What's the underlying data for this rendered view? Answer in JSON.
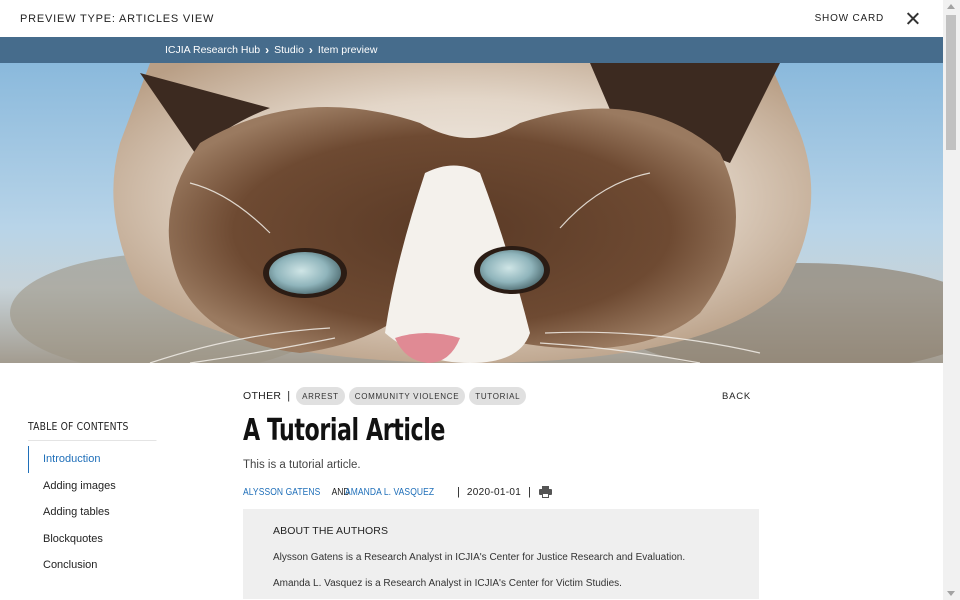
{
  "topbar": {
    "title": "PREVIEW TYPE: ARTICLES VIEW",
    "show_card_label": "SHOW CARD",
    "close_icon": "close-icon"
  },
  "breadcrumb": {
    "items": [
      "ICJIA Research Hub",
      "Studio",
      "Item preview"
    ],
    "separator_icon": "chevron-right-icon"
  },
  "hero": {
    "image": "grumpy cat face close-up against blue sky"
  },
  "toc": {
    "title": "TABLE OF CONTENTS",
    "items": [
      "Introduction",
      "Adding images",
      "Adding tables",
      "Blockquotes",
      "Conclusion"
    ],
    "active_index": 0
  },
  "article": {
    "category": "OTHER",
    "tags": [
      "ARREST",
      "COMMUNITY VIOLENCE",
      "TUTORIAL"
    ],
    "back_label": "BACK",
    "title": "A Tutorial Article",
    "abstract": "This is a tutorial article.",
    "authors": [
      "ALYSSON GATENS",
      "AMANDA L. VASQUEZ"
    ],
    "and_label": "AND",
    "date": "2020-01-01",
    "print_icon": "print-icon"
  },
  "about_authors": {
    "title": "ABOUT THE AUTHORS",
    "bios": [
      "Alysson Gatens is a Research Analyst in ICJIA's Center for Justice Research and Evaluation.",
      "Amanda L. Vasquez is a Research Analyst in ICJIA's Center for Victim Studies."
    ]
  },
  "colors": {
    "accent": "#1f6fb9",
    "breadcrumb_bar": "#466c8c",
    "chip_bg": "#e0e0e0",
    "authors_box_bg": "#efefef"
  }
}
